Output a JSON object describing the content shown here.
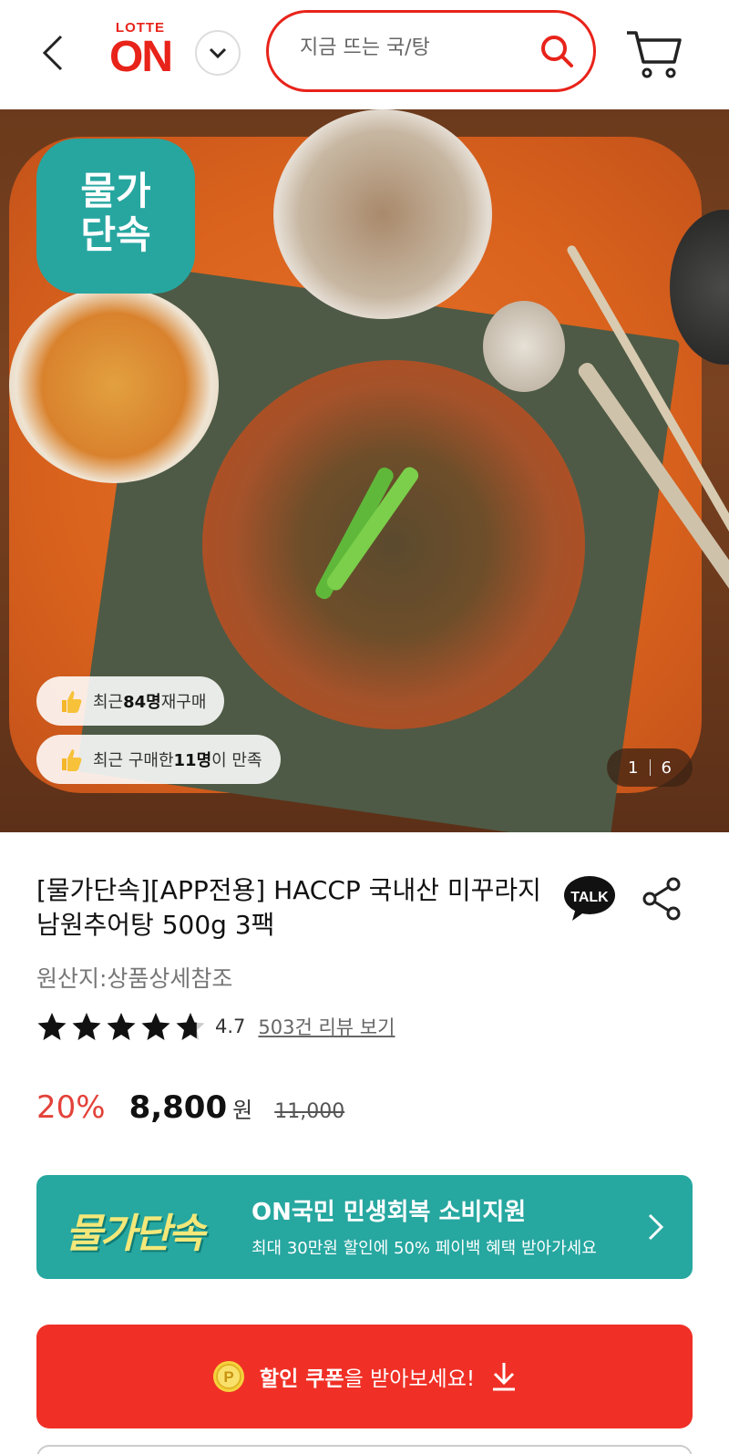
{
  "header": {
    "logo_top": "LOTTE",
    "logo_main": "ON",
    "search_placeholder": "지금 뜨는 국/탕"
  },
  "hero": {
    "sale_badge_line1": "물가",
    "sale_badge_line2": "단속",
    "pill_repurchase": {
      "prefix": "최근 ",
      "count": "84명",
      "suffix": " 재구매"
    },
    "pill_satisfied": {
      "prefix": "최근 구매한 ",
      "count": "11명",
      "suffix": "이 만족"
    },
    "pager": {
      "current": "1",
      "total": "6"
    }
  },
  "product": {
    "title": "[물가단속][APP전용] HACCP 국내산 미꾸라지 남원추어탕 500g 3팩",
    "talk_label": "TALK",
    "origin": "원산지:상품상세참조",
    "rating": "4.7",
    "stars_filled": 4.7,
    "review_link": "503건 리뷰 보기",
    "discount": "20%",
    "price": "8,800",
    "currency": "원",
    "original_price": "11,000"
  },
  "promo": {
    "logo_text": "물가단속",
    "title": "ON국민 민생회복 소비지원",
    "subtitle": "최대 30만원 할인에 50% 페이백 혜택 받아가세요"
  },
  "coupon": {
    "bold": "할인 쿠폰",
    "rest": "을 받아보세요!"
  },
  "colors": {
    "brand_red": "#e8231a",
    "teal": "#26a7a0",
    "coupon_red": "#f03026",
    "discount_red": "#e3423a"
  }
}
